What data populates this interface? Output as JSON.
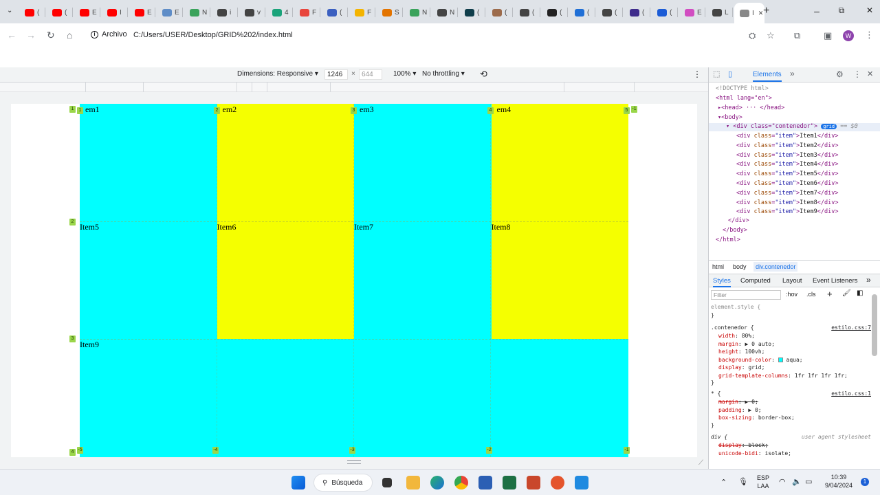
{
  "browser": {
    "tabs": [
      {
        "icon": "youtube-icon",
        "color": "#ff0000",
        "label": "("
      },
      {
        "icon": "youtube-icon",
        "color": "#ff0000",
        "label": "("
      },
      {
        "icon": "youtube-icon",
        "color": "#ff0000",
        "label": "E"
      },
      {
        "icon": "youtube-icon",
        "color": "#ff0000",
        "label": "I"
      },
      {
        "icon": "youtube-icon",
        "color": "#ff0000",
        "label": "E"
      },
      {
        "icon": "chart-icon",
        "color": "#5f8dc7",
        "label": "E"
      },
      {
        "icon": "px-icon",
        "color": "#3aa35b",
        "label": "N"
      },
      {
        "icon": "globe-icon",
        "color": "#444444",
        "label": "i"
      },
      {
        "icon": "globe-icon",
        "color": "#444444",
        "label": "v"
      },
      {
        "icon": "d-icon",
        "color": "#1aa37a",
        "label": "4"
      },
      {
        "icon": "grid-icon",
        "color": "#e8453c",
        "label": "F"
      },
      {
        "icon": "bookmark-icon",
        "color": "#3b5fc0",
        "label": "("
      },
      {
        "icon": "drive-icon",
        "color": "#f4b400",
        "label": "F"
      },
      {
        "icon": "puzzle-icon",
        "color": "#e37400",
        "label": "S"
      },
      {
        "icon": "px-icon",
        "color": "#3aa35b",
        "label": "N"
      },
      {
        "icon": "globe-icon",
        "color": "#444444",
        "label": "N"
      },
      {
        "icon": "frame-icon",
        "color": "#0f3d4a",
        "label": "("
      },
      {
        "icon": "cookie-icon",
        "color": "#9c6b4b",
        "label": "("
      },
      {
        "icon": "globe-icon",
        "color": "#444444",
        "label": "("
      },
      {
        "icon": "moon-icon",
        "color": "#222222",
        "label": "("
      },
      {
        "icon": "html5-icon",
        "color": "#1f6fd6",
        "label": "("
      },
      {
        "icon": "globe-icon",
        "color": "#444444",
        "label": "("
      },
      {
        "icon": "circle-icon",
        "color": "#3f2c8c",
        "label": "("
      },
      {
        "icon": "a-icon",
        "color": "#1c5cd6",
        "label": "("
      },
      {
        "icon": "play-icon",
        "color": "#d14dc1",
        "label": "E"
      },
      {
        "icon": "globe-icon",
        "color": "#444444",
        "label": "L"
      },
      {
        "icon": "page-icon",
        "color": "#888888",
        "label": "I"
      }
    ],
    "new_tab": "+",
    "window_controls": {
      "minimize": "–",
      "maximize": "⧉",
      "close": "✕"
    },
    "secure_chip": "Archivo",
    "url": "C:/Users/USER/Desktop/GRID%202/index.html"
  },
  "device_toolbar": {
    "dimensions_label": "Dimensions: Responsive",
    "width": "1246",
    "times": "×",
    "height": "644",
    "zoom": "100%",
    "throttling": "No throttling"
  },
  "page": {
    "items": [
      {
        "text": "em1",
        "color": "aqua"
      },
      {
        "text": "em2",
        "color": "yellow"
      },
      {
        "text": "em3",
        "color": "aqua"
      },
      {
        "text": "em4",
        "color": "yellow"
      },
      {
        "text": "Item5",
        "color": "aqua"
      },
      {
        "text": "Item6",
        "color": "yellow"
      },
      {
        "text": "Item7",
        "color": "aqua"
      },
      {
        "text": "Item8",
        "color": "yellow"
      },
      {
        "text": "Item9",
        "color": "aqua"
      }
    ],
    "grid_badges": {
      "top": [
        "1",
        "2",
        "3",
        "4",
        "5",
        "-1"
      ],
      "left": [
        "1",
        "2",
        "3",
        "4"
      ],
      "bottom": [
        "-5",
        "-4",
        "-3",
        "-2",
        "-1"
      ]
    }
  },
  "devtools": {
    "tabs": {
      "elements": "Elements",
      "more": "»"
    },
    "dom": {
      "doctype": "<!DOCTYPE html>",
      "html_open": "<html lang=\"en\">",
      "head": "<head> ··· </head>",
      "body_open": "<body>",
      "div_open": "<div class=\"contenedor\">",
      "grid_badge": "grid",
      "eq0": "== $0",
      "items": [
        "Item1",
        "Item2",
        "Item3",
        "Item4",
        "Item5",
        "Item6",
        "Item7",
        "Item8",
        "Item9"
      ],
      "div_close": "</div>",
      "body_close": "</body>",
      "html_close": "</html>"
    },
    "breadcrumbs": [
      "html",
      "body",
      "div.contenedor"
    ],
    "styles_tabs": [
      "Styles",
      "Computed",
      "Layout",
      "Event Listeners",
      "»"
    ],
    "filter_placeholder": "Filter",
    "filter_tools": [
      ":hov",
      ".cls",
      "+"
    ],
    "rules": {
      "element_style": "element.style {",
      "close": "}",
      "contenedor_selector": ".contenedor {",
      "contenedor_src": "estilo.css:7",
      "contenedor_props": [
        {
          "name": "width",
          "value": "80%;"
        },
        {
          "name": "margin",
          "value": "▶ 0 auto;"
        },
        {
          "name": "height",
          "value": "100vh;"
        },
        {
          "name": "background-color",
          "value": "aqua;"
        },
        {
          "name": "display",
          "value": "grid;"
        },
        {
          "name": "grid-template-columns",
          "value": "1fr 1fr 1fr 1fr;"
        }
      ],
      "star_selector": "* {",
      "star_src": "estilo.css:1",
      "star_props": [
        {
          "name": "margin",
          "value": "▶ 0;"
        },
        {
          "name": "padding",
          "value": "▶ 0;"
        },
        {
          "name": "box-sizing",
          "value": "border-box;"
        }
      ],
      "div_selector": "div {",
      "div_src": "user agent stylesheet",
      "div_props": [
        {
          "name": "display",
          "value": "block;"
        },
        {
          "name": "unicode-bidi",
          "value": "isolate;"
        }
      ]
    }
  },
  "taskbar": {
    "search_label": "Búsqueda",
    "lang_top": "ESP",
    "lang_bottom": "LAA",
    "time": "10:39",
    "date": "9/04/2024",
    "notif_count": "1"
  }
}
